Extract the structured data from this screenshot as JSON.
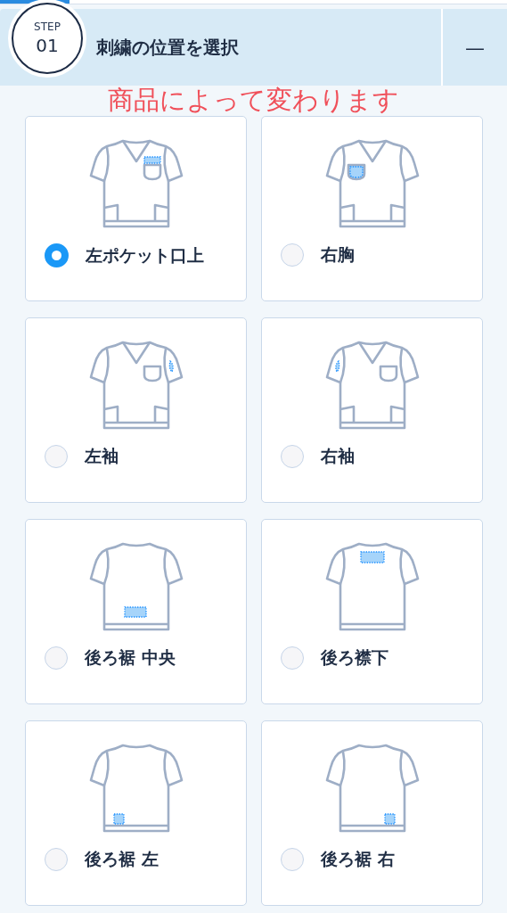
{
  "step": {
    "label": "STEP",
    "number": "01",
    "title": "刺繍の位置を選択",
    "toggle": "—"
  },
  "note": "商品によって変わります",
  "options": [
    {
      "label": "左ポケット口上",
      "selected": true
    },
    {
      "label": "右胸",
      "selected": false
    },
    {
      "label": "左袖",
      "selected": false
    },
    {
      "label": "右袖",
      "selected": false
    },
    {
      "label": "後ろ裾 中央",
      "selected": false
    },
    {
      "label": "後ろ襟下",
      "selected": false
    },
    {
      "label": "後ろ裾 左",
      "selected": false
    },
    {
      "label": "後ろ裾 右",
      "selected": false
    }
  ]
}
